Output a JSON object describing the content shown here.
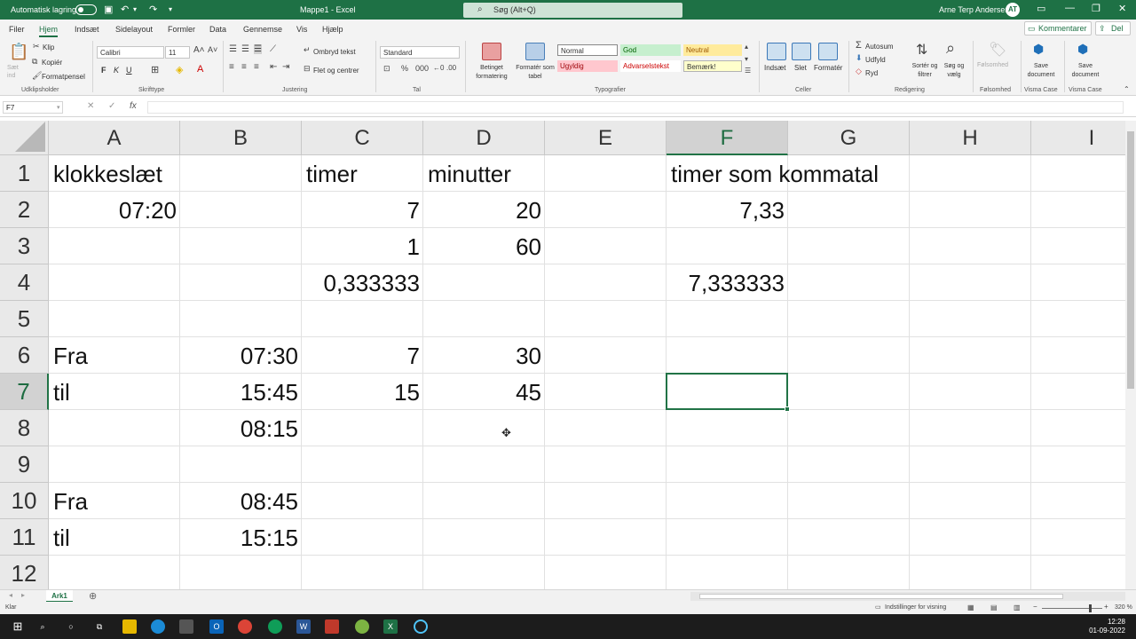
{
  "titlebar": {
    "autosave_label": "Automatisk lagring",
    "title": "Mappe1 - Excel",
    "search_placeholder": "Søg (Alt+Q)",
    "user": "Arne Terp Andersen",
    "avatar": "AT"
  },
  "menu": {
    "items": [
      "Filer",
      "Hjem",
      "Indsæt",
      "Sidelayout",
      "Formler",
      "Data",
      "Gennemse",
      "Vis",
      "Hjælp"
    ],
    "comment_button": "Kommentarer",
    "share_button": "Del"
  },
  "ribbon": {
    "clipboard": {
      "paste": "Sæt ind",
      "cut": "Klip",
      "copy": "Kopiér",
      "format_painter": "Formatpensel",
      "group": "Udklipsholder"
    },
    "font": {
      "name": "Calibri",
      "size": "11",
      "bold": "F",
      "italic": "K",
      "underline": "U",
      "group": "Skrifttype"
    },
    "alignment": {
      "wrap": "Ombryd tekst",
      "merge": "Flet og centrer",
      "group": "Justering"
    },
    "number": {
      "format": "Standard",
      "group": "Tal"
    },
    "styles": {
      "conditional": "Betinget formatering",
      "table": "Formatér som tabel",
      "normal": "Normal",
      "good": "God",
      "neutral": "Neutral",
      "bad": "Ugyldig",
      "warning": "Advarselstekst",
      "note": "Bemærk!",
      "group": "Typografier"
    },
    "cells": {
      "insert": "Indsæt",
      "delete": "Slet",
      "format": "Formatér",
      "group": "Celler"
    },
    "editing": {
      "autosum": "Autosum",
      "fill": "Udfyld",
      "clear": "Ryd",
      "sort": "Sortér og filtrer",
      "find": "Søg og vælg",
      "group": "Redigering"
    },
    "sensitivity": {
      "label": "Følsomhed",
      "group": "Følsomhed"
    },
    "visma1": {
      "label": "Save document",
      "group": "Visma Case"
    },
    "visma2": {
      "label": "Save document",
      "group": "Visma Case"
    }
  },
  "formula_bar": {
    "name_box": "F7",
    "fx": "fx",
    "content": ""
  },
  "columns": [
    "A",
    "B",
    "C",
    "D",
    "E",
    "F",
    "G",
    "H",
    "I"
  ],
  "rows": [
    "1",
    "2",
    "3",
    "4",
    "5",
    "6",
    "7",
    "8",
    "9",
    "10",
    "11",
    "12"
  ],
  "selected_cell": "F7",
  "cells": {
    "A1": "klokkeslæt",
    "C1": "timer",
    "D1": "minutter",
    "F1": "timer som kommatal",
    "A2": "07:20",
    "C2": "7",
    "D2": "20",
    "F2": "7,33",
    "C3": "1",
    "D3": "60",
    "C4": "0,333333",
    "F4": "7,333333",
    "A6": "Fra",
    "B6": "07:30",
    "C6": "7",
    "D6": "30",
    "A7": "til",
    "B7": "15:45",
    "C7": "15",
    "D7": "45",
    "B8": "08:15",
    "A10": "Fra",
    "B10": "08:45",
    "A11": "til",
    "B11": "15:15"
  },
  "sheet_tab": "Ark1",
  "status": {
    "ready": "Klar",
    "display_settings": "Indstillinger for visning",
    "zoom": "320 %"
  },
  "taskbar": {
    "time": "12:28",
    "date": "01-09-2022"
  }
}
